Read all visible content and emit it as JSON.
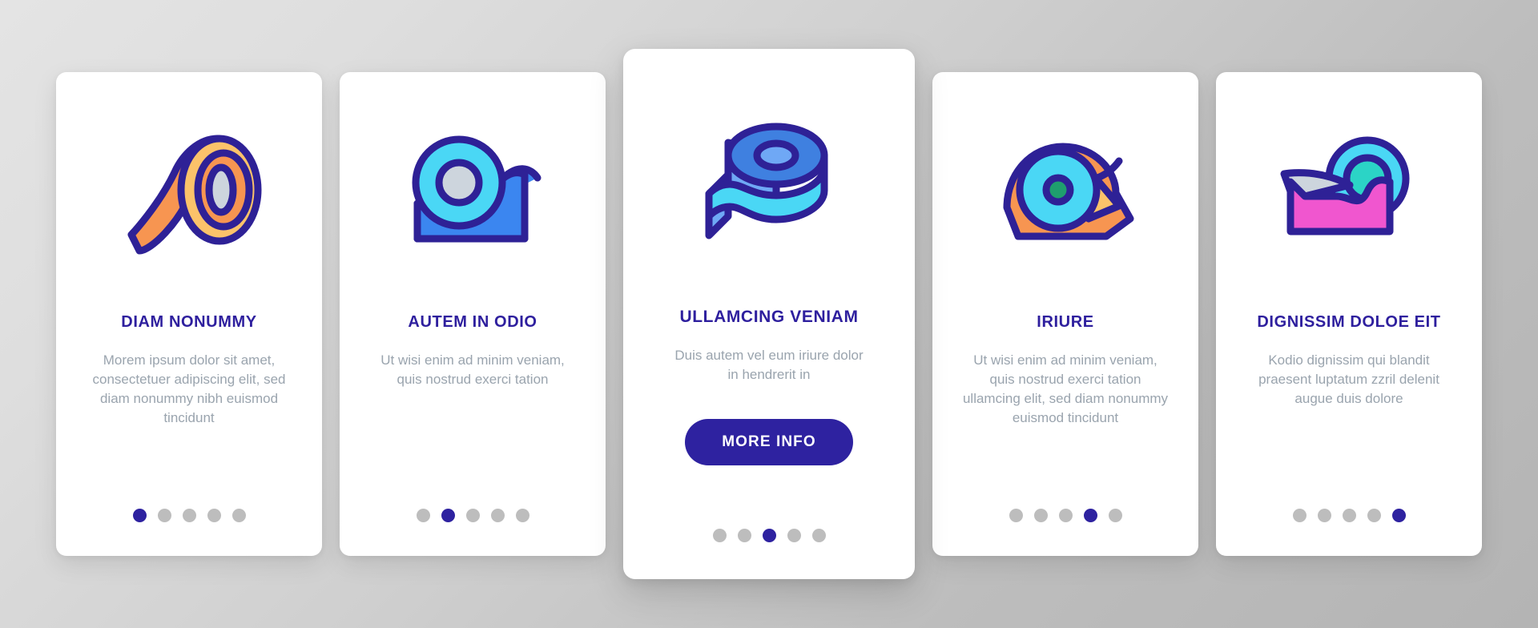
{
  "theme": {
    "background_start": "#e4e4e4",
    "background_end": "#b4b4b4",
    "card_background": "#ffffff",
    "title_color": "#2e1f9e",
    "body_color": "#9aa4ae",
    "accent_color": "#2e22a0",
    "dot_inactive_color": "#bdbdbd",
    "outline_color": "#2e2196",
    "orange": "#f79551",
    "light_orange": "#fbc26a",
    "cyan": "#4ad7f5",
    "light_cyan": "#5fe0fa",
    "blue": "#3b86f0",
    "mid_blue": "#3f80e0",
    "pink": "#f056cf",
    "green": "#1f9e6e",
    "grey_fill": "#cdd5dd"
  },
  "cards": [
    {
      "icon": "tape-roll-orange-icon",
      "title": "DIAM NONUMMY",
      "body": "Morem ipsum dolor sit amet, consectetuer adipiscing elit, sed diam nonummy nibh euismod tincidunt",
      "featured": false,
      "dots": {
        "count": 5,
        "active_index": 0
      }
    },
    {
      "icon": "tape-dispenser-blue-icon",
      "title": "AUTEM IN ODIO",
      "body": "Ut wisi enim ad minim veniam, quis nostrud exerci tation",
      "featured": false,
      "dots": {
        "count": 5,
        "active_index": 1
      }
    },
    {
      "icon": "tape-roll-blue-icon",
      "title": "ULLAMCING VENIAM",
      "body": "Duis autem vel eum iriure dolor in hendrerit in",
      "featured": true,
      "cta_label": "MORE INFO",
      "dots": {
        "count": 5,
        "active_index": 2
      }
    },
    {
      "icon": "tape-dispenser-orange-icon",
      "title": "IRIURE",
      "body": "Ut wisi enim ad minim veniam, quis nostrud exerci tation ullamcing elit, sed diam nonummy euismod tincidunt",
      "featured": false,
      "dots": {
        "count": 5,
        "active_index": 3
      }
    },
    {
      "icon": "tape-dispenser-pink-icon",
      "title": "DIGNISSIM DOLOE EIT",
      "body": "Kodio dignissim qui blandit praesent luptatum zzril delenit augue duis dolore",
      "featured": false,
      "dots": {
        "count": 5,
        "active_index": 4
      }
    }
  ]
}
